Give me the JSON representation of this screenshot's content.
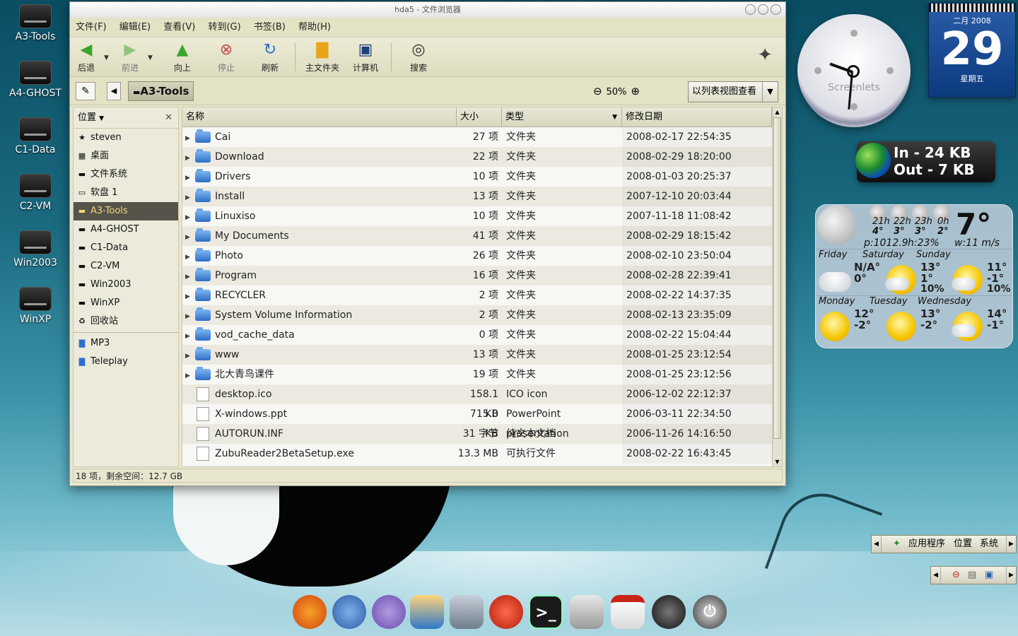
{
  "desktop": {
    "icons": [
      "A3-Tools",
      "A4-GHOST",
      "C1-Data",
      "C2-VM",
      "Win2003",
      "WinXP"
    ]
  },
  "window": {
    "title": "hda5 - 文件浏览器",
    "menu": [
      "文件(F)",
      "编辑(E)",
      "查看(V)",
      "转到(G)",
      "书签(B)",
      "帮助(H)"
    ],
    "toolbar": {
      "back": "后退",
      "forward": "前进",
      "up": "向上",
      "stop": "停止",
      "reload": "刷新",
      "home": "主文件夹",
      "computer": "计算机",
      "search": "搜索"
    },
    "location": {
      "crumb": "A3-Tools",
      "zoom": "50%",
      "view_mode": "以列表视图查看"
    },
    "sidebar": {
      "header": "位置",
      "items": [
        "steven",
        "桌面",
        "文件系统",
        "软盘 1",
        "A3-Tools",
        "A4-GHOST",
        "C1-Data",
        "C2-VM",
        "Win2003",
        "WinXP",
        "回收站"
      ],
      "bookmarks": [
        "MP3",
        "Teleplay"
      ],
      "selected": "A3-Tools"
    },
    "columns": {
      "name": "名称",
      "size": "大小",
      "type": "类型",
      "date": "修改日期"
    },
    "files": [
      {
        "name": "Cai",
        "size": "27 项",
        "type": "文件夹",
        "date": "2008-02-17 22:54:35",
        "kind": "folder"
      },
      {
        "name": "Download",
        "size": "22 项",
        "type": "文件夹",
        "date": "2008-02-29 18:20:00",
        "kind": "folder"
      },
      {
        "name": "Drivers",
        "size": "10 项",
        "type": "文件夹",
        "date": "2008-01-03 20:25:37",
        "kind": "folder"
      },
      {
        "name": "Install",
        "size": "13 项",
        "type": "文件夹",
        "date": "2007-12-10 20:03:44",
        "kind": "folder"
      },
      {
        "name": "Linuxiso",
        "size": "10 项",
        "type": "文件夹",
        "date": "2007-11-18 11:08:42",
        "kind": "folder"
      },
      {
        "name": "My Documents",
        "size": "41 项",
        "type": "文件夹",
        "date": "2008-02-29 18:15:42",
        "kind": "folder"
      },
      {
        "name": "Photo",
        "size": "26 项",
        "type": "文件夹",
        "date": "2008-02-10 23:50:04",
        "kind": "folder"
      },
      {
        "name": "Program",
        "size": "16 项",
        "type": "文件夹",
        "date": "2008-02-28 22:39:41",
        "kind": "folder"
      },
      {
        "name": "RECYCLER",
        "size": "2 项",
        "type": "文件夹",
        "date": "2008-02-22 14:37:35",
        "kind": "folder"
      },
      {
        "name": "System Volume Information",
        "size": "2 项",
        "type": "文件夹",
        "date": "2008-02-13 23:35:09",
        "kind": "folder"
      },
      {
        "name": "vod_cache_data",
        "size": "0 项",
        "type": "文件夹",
        "date": "2008-02-22 15:04:44",
        "kind": "folder"
      },
      {
        "name": "www",
        "size": "13 项",
        "type": "文件夹",
        "date": "2008-01-25 23:12:54",
        "kind": "folder"
      },
      {
        "name": "北大青鸟课件",
        "size": "19 项",
        "type": "文件夹",
        "date": "2008-01-25 23:12:56",
        "kind": "folder"
      },
      {
        "name": "desktop.ico",
        "size": "158.1 KB",
        "type": "ICO icon",
        "date": "2006-12-02 22:12:37",
        "kind": "file"
      },
      {
        "name": "X-windows.ppt",
        "size": "715.0 KB",
        "type": "PowerPoint presentation",
        "date": "2006-03-11 22:34:50",
        "kind": "file"
      },
      {
        "name": "AUTORUN.INF",
        "size": "31 字节",
        "type": "纯文本文档",
        "date": "2006-11-26 14:16:50",
        "kind": "file"
      },
      {
        "name": "ZubuReader2BetaSetup.exe",
        "size": "13.3 MB",
        "type": "可执行文件",
        "date": "2008-02-22 16:43:45",
        "kind": "file"
      }
    ],
    "status": "18 项，剩余空间：12.7 GB"
  },
  "widgets": {
    "clock_label": "Screenlets",
    "calendar": {
      "month": "二月 2008",
      "day": "29",
      "weekday": "星期五"
    },
    "net": {
      "in": "In -  24  KB",
      "out": "Out - 7  KB"
    },
    "weather": {
      "current_temp": "7°",
      "hours": [
        {
          "label": "21h",
          "temp": "4°"
        },
        {
          "label": "22h",
          "temp": "3°"
        },
        {
          "label": "23h",
          "temp": "3°"
        },
        {
          "label": "0h",
          "temp": "2°"
        }
      ],
      "pressure": "p:1012.9",
      "humidity": "h:23%",
      "wind": "w:11 m/s",
      "days": [
        {
          "day": "Friday",
          "hi": "N/A°",
          "lo": "0°",
          "pct": ""
        },
        {
          "day": "Saturday",
          "hi": "13°",
          "lo": "1°",
          "pct": "10%"
        },
        {
          "day": "Sunday",
          "hi": "11°",
          "lo": "-1°",
          "pct": "10%"
        },
        {
          "day": "Monday",
          "hi": "12°",
          "lo": "-2°",
          "pct": ""
        },
        {
          "day": "Tuesday",
          "hi": "13°",
          "lo": "-2°",
          "pct": ""
        },
        {
          "day": "Wednesday",
          "hi": "14°",
          "lo": "-1°",
          "pct": ""
        }
      ]
    }
  },
  "panel": {
    "apps": "应用程序",
    "places": "位置",
    "system": "系统"
  },
  "dock": [
    "firefox",
    "thunderbird",
    "pidgin",
    "virtualbox",
    "movie-player",
    "devil-icon",
    "terminal",
    "file-cabinet",
    "pdf",
    "audio",
    "shutdown"
  ]
}
